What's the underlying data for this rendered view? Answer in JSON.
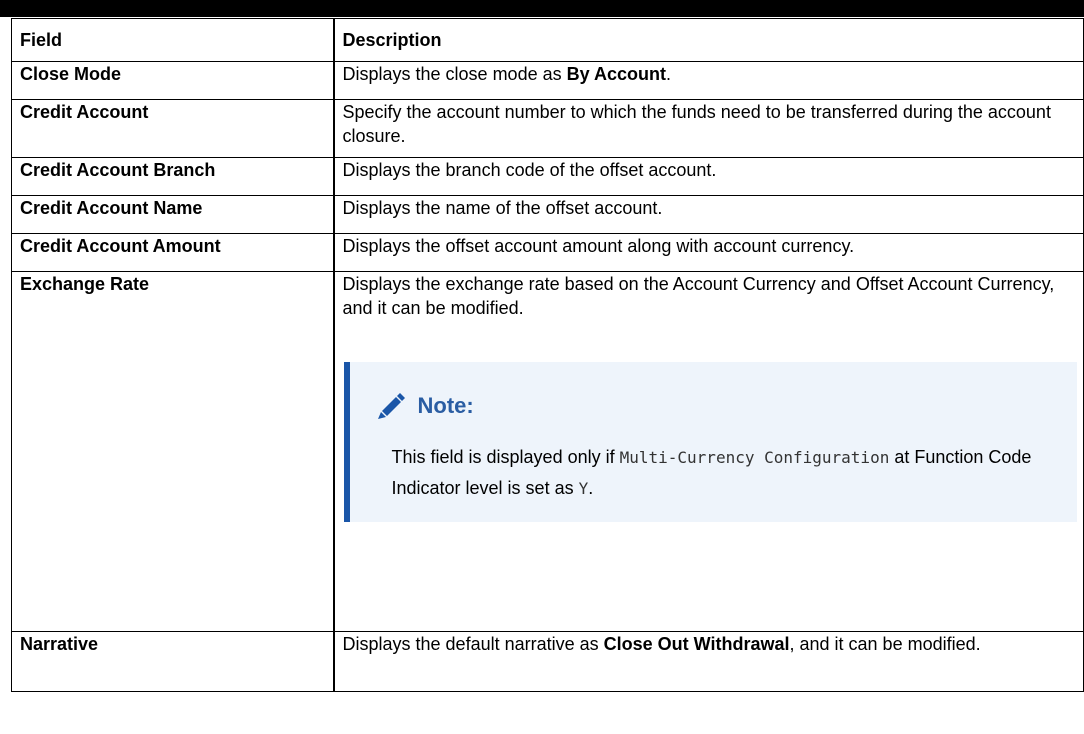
{
  "table": {
    "header": {
      "field": "Field",
      "description": "Description"
    },
    "rows": [
      {
        "field": "Close Mode",
        "desc_prefix": "Displays the close mode as ",
        "desc_bold": "By Account",
        "desc_suffix": "."
      },
      {
        "field": "Credit Account",
        "desc": "Specify the account number to which the funds need to be transferred during the account closure."
      },
      {
        "field": "Credit Account Branch",
        "desc": "Displays the branch code of the offset account."
      },
      {
        "field": "Credit Account Name",
        "desc": "Displays the name of the offset account."
      },
      {
        "field": "Credit Account Amount",
        "desc": "Displays the offset account amount along with account currency."
      },
      {
        "field": "Exchange Rate",
        "desc": "Displays the exchange rate based on the Account Currency and Offset Account Currency, and it can be modified.",
        "note": {
          "icon": "pencil-icon",
          "title": "Note:",
          "text_before": "This field is displayed only if ",
          "code1": "Multi-Currency Configuration",
          "text_middle": " at Function Code Indicator level is set as ",
          "code2": "Y",
          "text_after": "."
        }
      },
      {
        "field": "Narrative",
        "desc_prefix": "Displays the default narrative as ",
        "desc_bold": "Close Out Withdrawal",
        "desc_suffix": ", and it can be modified."
      }
    ]
  },
  "colors": {
    "note_accent": "#1a56a8",
    "note_background": "#eef4fb",
    "note_title": "#2a5da3"
  }
}
